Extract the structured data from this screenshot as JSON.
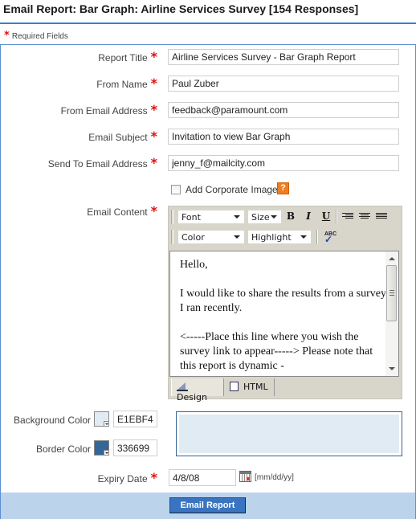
{
  "page": {
    "title": "Email Report: Bar Graph:  Airline Services Survey [154 Responses]",
    "required_legend": "Required Fields"
  },
  "form": {
    "report_title": {
      "label": "Report Title",
      "value": "Airline Services Survey - Bar Graph Report"
    },
    "from_name": {
      "label": "From Name",
      "value": "Paul Zuber"
    },
    "from_email": {
      "label": "From Email Address",
      "value": "feedback@paramount.com"
    },
    "email_subject": {
      "label": "Email Subject",
      "value": "Invitation to view Bar Graph"
    },
    "send_to": {
      "label": "Send To Email Address",
      "value": "jenny_f@mailcity.com"
    },
    "corporate_image": {
      "label": "Add Corporate Image",
      "checked": false,
      "help": "?"
    },
    "email_content": {
      "label": "Email Content",
      "toolbar": {
        "font": "Font",
        "size": "Size",
        "bold": "B",
        "italic": "I",
        "underline": "U",
        "color": "Color",
        "highlight": "Highlight",
        "spellcheck": "ABC"
      },
      "paragraphs": [
        "Hello,",
        "I would like to share the results from a survey I ran recently.",
        "<-----Place this line where you wish the survey link to appear-----> Please note that this report is dynamic -"
      ],
      "tabs": [
        {
          "label": "Design",
          "active": true
        },
        {
          "label": "HTML",
          "active": false
        }
      ]
    },
    "background_color": {
      "label": "Background Color",
      "value": "E1EBF4",
      "swatch": "#e1ebf4"
    },
    "border_color": {
      "label": "Border Color",
      "value": "336699",
      "swatch": "#336699"
    },
    "expiry_date": {
      "label": "Expiry Date",
      "value": "4/8/08",
      "hint": "[mm/dd/yy]"
    },
    "submit_label": "Email Report"
  },
  "colors": {
    "accent": "#3d7cc9",
    "required": "#e01010",
    "footer": "#bcd3ec",
    "button": "#3a74c0"
  }
}
